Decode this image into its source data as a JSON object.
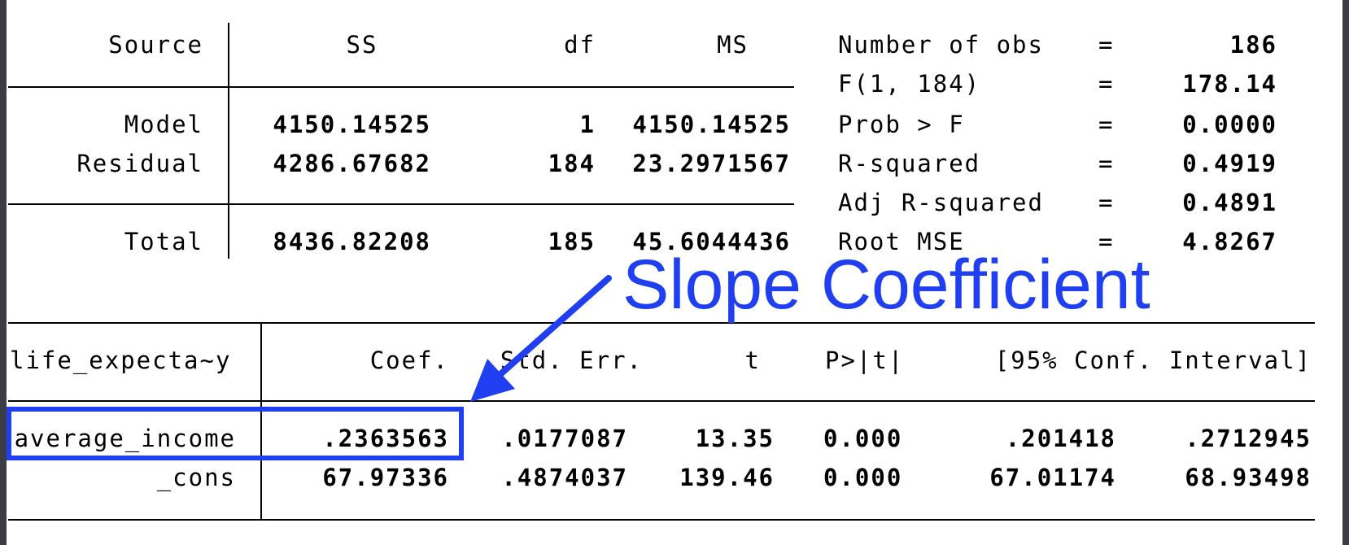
{
  "anova": {
    "headers": {
      "source": "Source",
      "ss": "SS",
      "df": "df",
      "ms": "MS"
    },
    "rows": [
      {
        "source": "Model",
        "ss": "4150.14525",
        "df": "1",
        "ms": "4150.14525"
      },
      {
        "source": "Residual",
        "ss": "4286.67682",
        "df": "184",
        "ms": "23.2971567"
      },
      {
        "source": "Total",
        "ss": "8436.82208",
        "df": "185",
        "ms": "45.6044436"
      }
    ]
  },
  "stats": [
    {
      "label": "Number of obs",
      "eq": "=",
      "value": "186"
    },
    {
      "label": "F(1, 184)",
      "eq": "=",
      "value": "178.14"
    },
    {
      "label": "Prob > F",
      "eq": "=",
      "value": "0.0000"
    },
    {
      "label": "R-squared",
      "eq": "=",
      "value": "0.4919"
    },
    {
      "label": "Adj R-squared",
      "eq": "=",
      "value": "0.4891"
    },
    {
      "label": "Root MSE",
      "eq": "=",
      "value": "4.8267"
    }
  ],
  "coef": {
    "headers": {
      "depvar": "life_expecta~y",
      "coef": "Coef.",
      "se": "Std. Err.",
      "t": "t",
      "p": "P>|t|",
      "ci": "[95% Conf. Interval]"
    },
    "rows": [
      {
        "var": "average_income",
        "coef": ".2363563",
        "se": ".0177087",
        "t": "13.35",
        "p": "0.000",
        "lo": ".201418",
        "hi": ".2712945"
      },
      {
        "var": "_cons",
        "coef": "67.97336",
        "se": ".4874037",
        "t": "139.46",
        "p": "0.000",
        "lo": "67.01174",
        "hi": "68.93498"
      }
    ]
  },
  "annotation": {
    "text": "Slope Coefficient",
    "color": "#1f3ff0"
  }
}
